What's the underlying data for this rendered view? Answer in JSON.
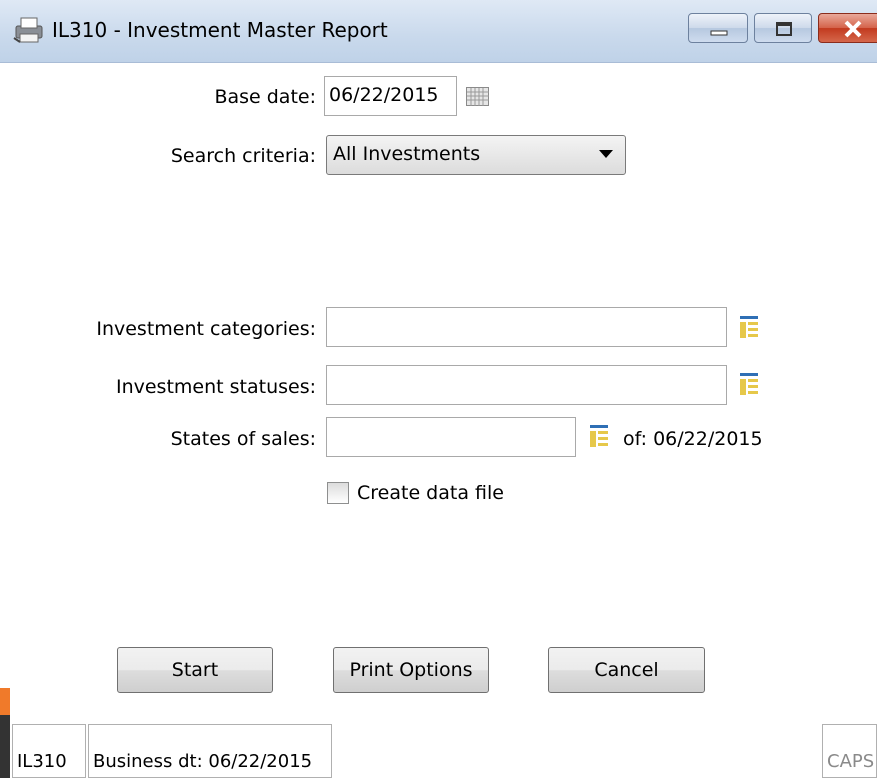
{
  "window": {
    "title": "IL310 - Investment Master Report"
  },
  "form": {
    "base_date_label": "Base date:",
    "base_date_value": "06/22/2015",
    "search_criteria_label": "Search criteria:",
    "search_criteria_value": "All Investments",
    "investment_categories_label": "Investment categories:",
    "investment_categories_value": "",
    "investment_statuses_label": "Investment statuses:",
    "investment_statuses_value": "",
    "states_of_sales_label": "States of sales:",
    "states_of_sales_value": "",
    "states_of_sales_of": "of: 06/22/2015",
    "create_data_file_label": "Create data file",
    "create_data_file_checked": false
  },
  "buttons": {
    "start": "Start",
    "print_options": "Print Options",
    "cancel": "Cancel"
  },
  "status": {
    "program": "IL310",
    "business_date": "Business dt: 06/22/2015",
    "caps": "CAPS"
  }
}
